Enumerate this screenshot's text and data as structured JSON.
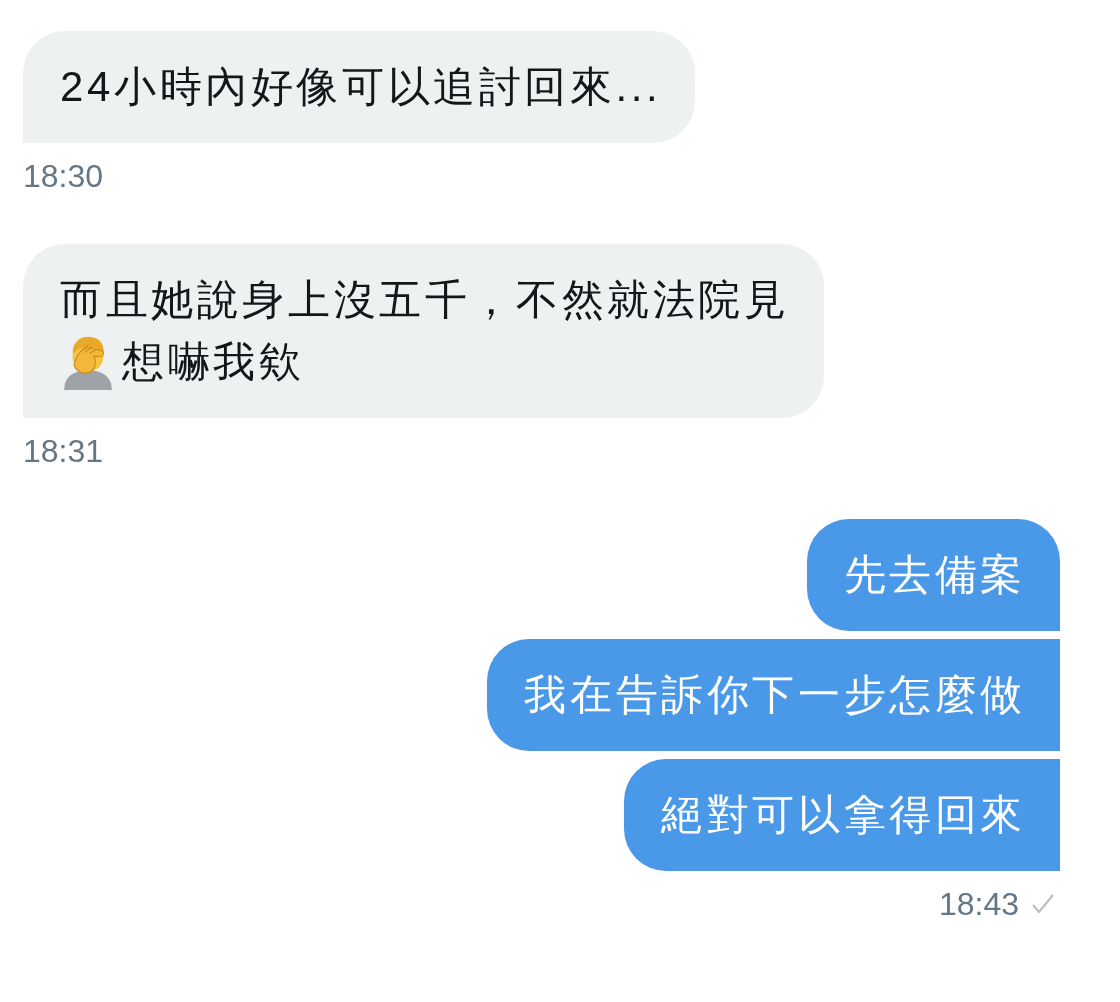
{
  "messages": [
    {
      "kind": "incoming",
      "bubbles": [
        {
          "lines": [
            [
              {
                "kind": "text",
                "text": "24小時內好像可以追討回來..."
              }
            ]
          ]
        }
      ],
      "time": "18:30"
    },
    {
      "kind": "incoming",
      "bubbles": [
        {
          "lines": [
            [
              {
                "kind": "text",
                "text": "而且她說身上沒五千，不然就法院見"
              }
            ],
            [
              {
                "kind": "emoji"
              },
              {
                "kind": "text",
                "text": "想嚇我欸"
              }
            ]
          ]
        }
      ],
      "time": "18:31"
    },
    {
      "kind": "outgoing",
      "bubbles": [
        {
          "lines": [
            [
              {
                "kind": "text",
                "text": "先去備案"
              }
            ]
          ]
        },
        {
          "lines": [
            [
              {
                "kind": "text",
                "text": "我在告訴你下一步怎麼做"
              }
            ]
          ]
        },
        {
          "lines": [
            [
              {
                "kind": "text",
                "text": "絕對可以拿得回來"
              }
            ]
          ]
        }
      ],
      "time": "18:43",
      "read": false
    }
  ]
}
